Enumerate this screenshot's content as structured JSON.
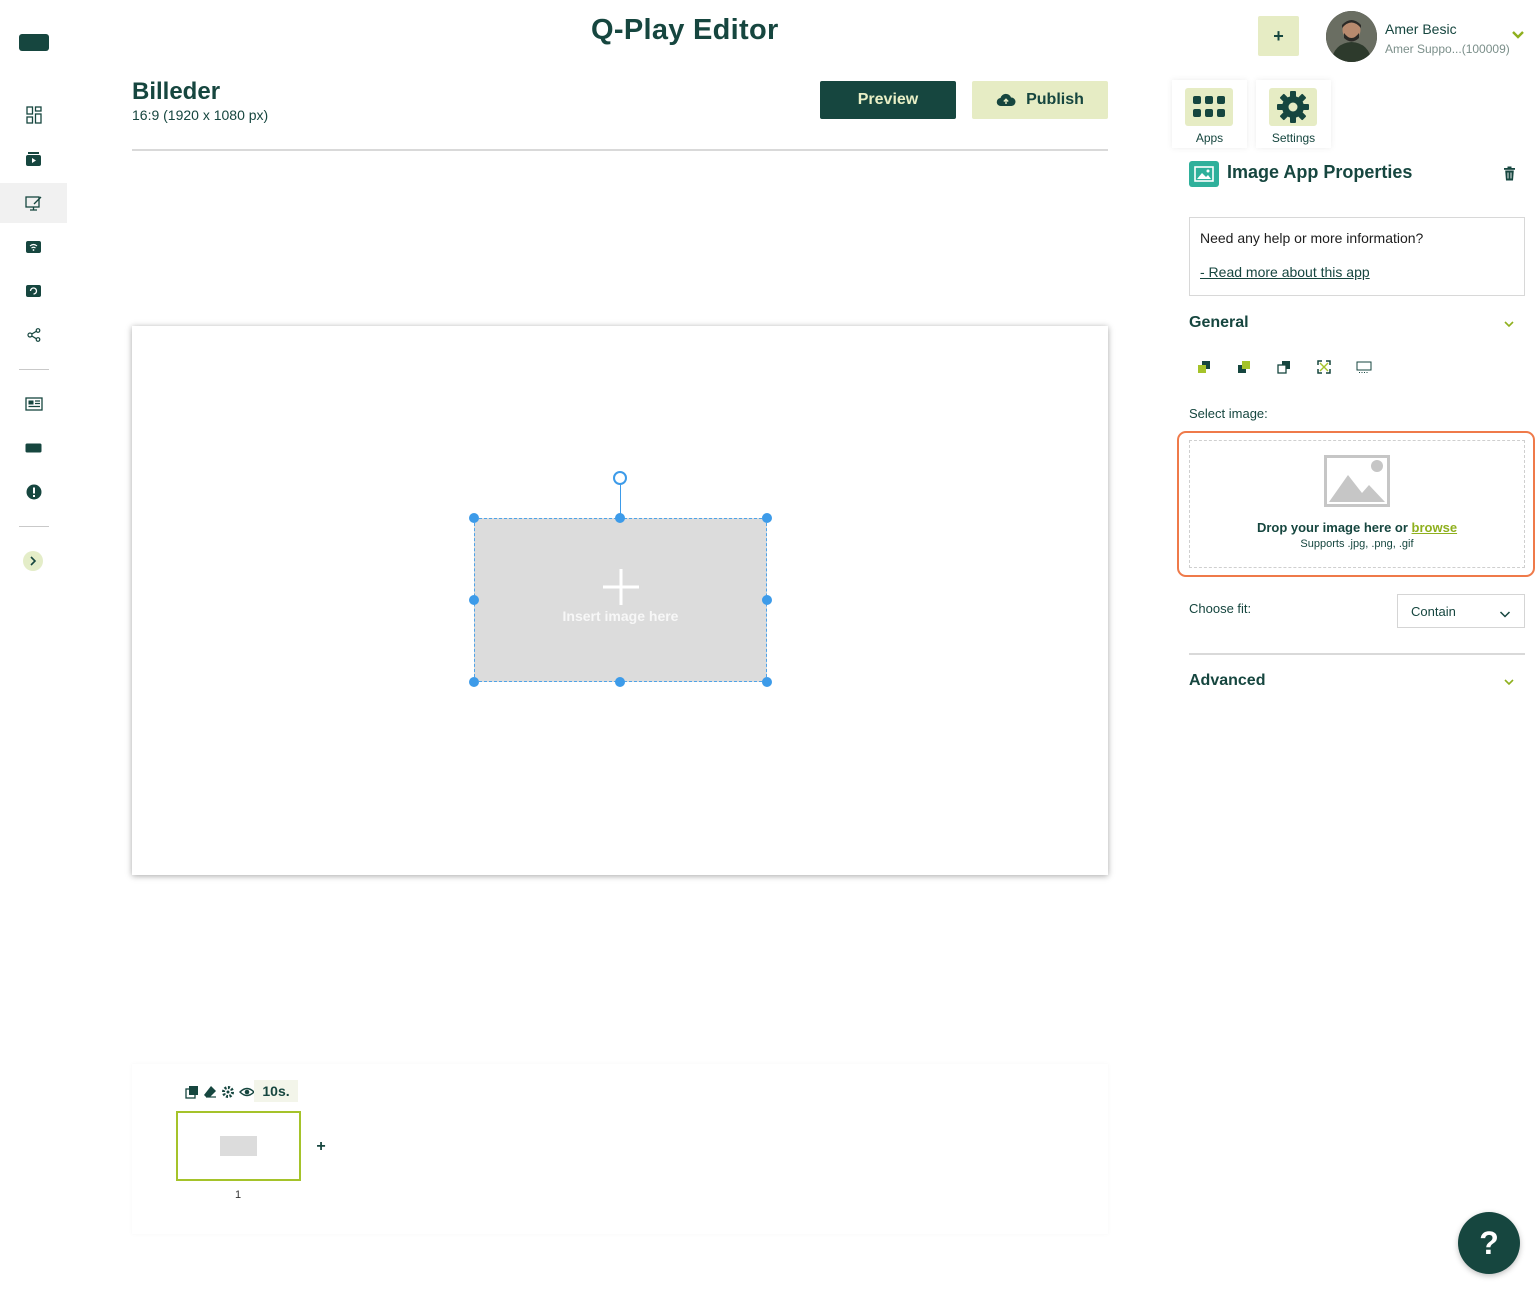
{
  "app": {
    "title": "Q-Play Editor"
  },
  "header": {
    "add_label": "+",
    "user_name": "Amer Besic",
    "user_sub": "Amer Suppo...(100009)"
  },
  "sidebar": {
    "items": [
      {
        "icon": "dashboard-icon"
      },
      {
        "icon": "media-icon"
      },
      {
        "icon": "editor-icon",
        "active": true
      },
      {
        "icon": "broadcast-icon"
      },
      {
        "icon": "refresh-screen-icon"
      },
      {
        "icon": "share-icon"
      },
      {
        "icon": "newspaper-icon"
      },
      {
        "icon": "display-icon"
      },
      {
        "icon": "alert-icon"
      }
    ],
    "expand_icon": "chevron-right-icon"
  },
  "page": {
    "title": "Billeder",
    "subtitle": "16:9 (1920 x 1080 px)",
    "preview_label": "Preview",
    "publish_label": "Publish"
  },
  "canvas": {
    "placeholder_label": "Insert image here"
  },
  "timeline": {
    "duration": "10s.",
    "slides": [
      {
        "number": "1"
      }
    ],
    "add_label": "+"
  },
  "panel": {
    "tabs": [
      {
        "label": "Apps",
        "icon": "apps-grid-icon"
      },
      {
        "label": "Settings",
        "icon": "gear-icon"
      }
    ],
    "title": "Image App Properties",
    "help_question": "Need any help or more information?",
    "help_link": "- Read more about this app",
    "general_title": "General",
    "select_image_label": "Select image:",
    "drop_text": "Drop your image here or",
    "browse_label": "browse",
    "drop_support": "Supports .jpg, .png, .gif",
    "fit_label": "Choose fit:",
    "fit_value": "Contain",
    "advanced_title": "Advanced"
  },
  "help_fab": "?",
  "colors": {
    "primary": "#16463f",
    "accent_light": "#e6ecc4",
    "accent_green": "#a5c32a",
    "selection_blue": "#3d9be9",
    "highlight_orange": "#ef7a4a"
  }
}
